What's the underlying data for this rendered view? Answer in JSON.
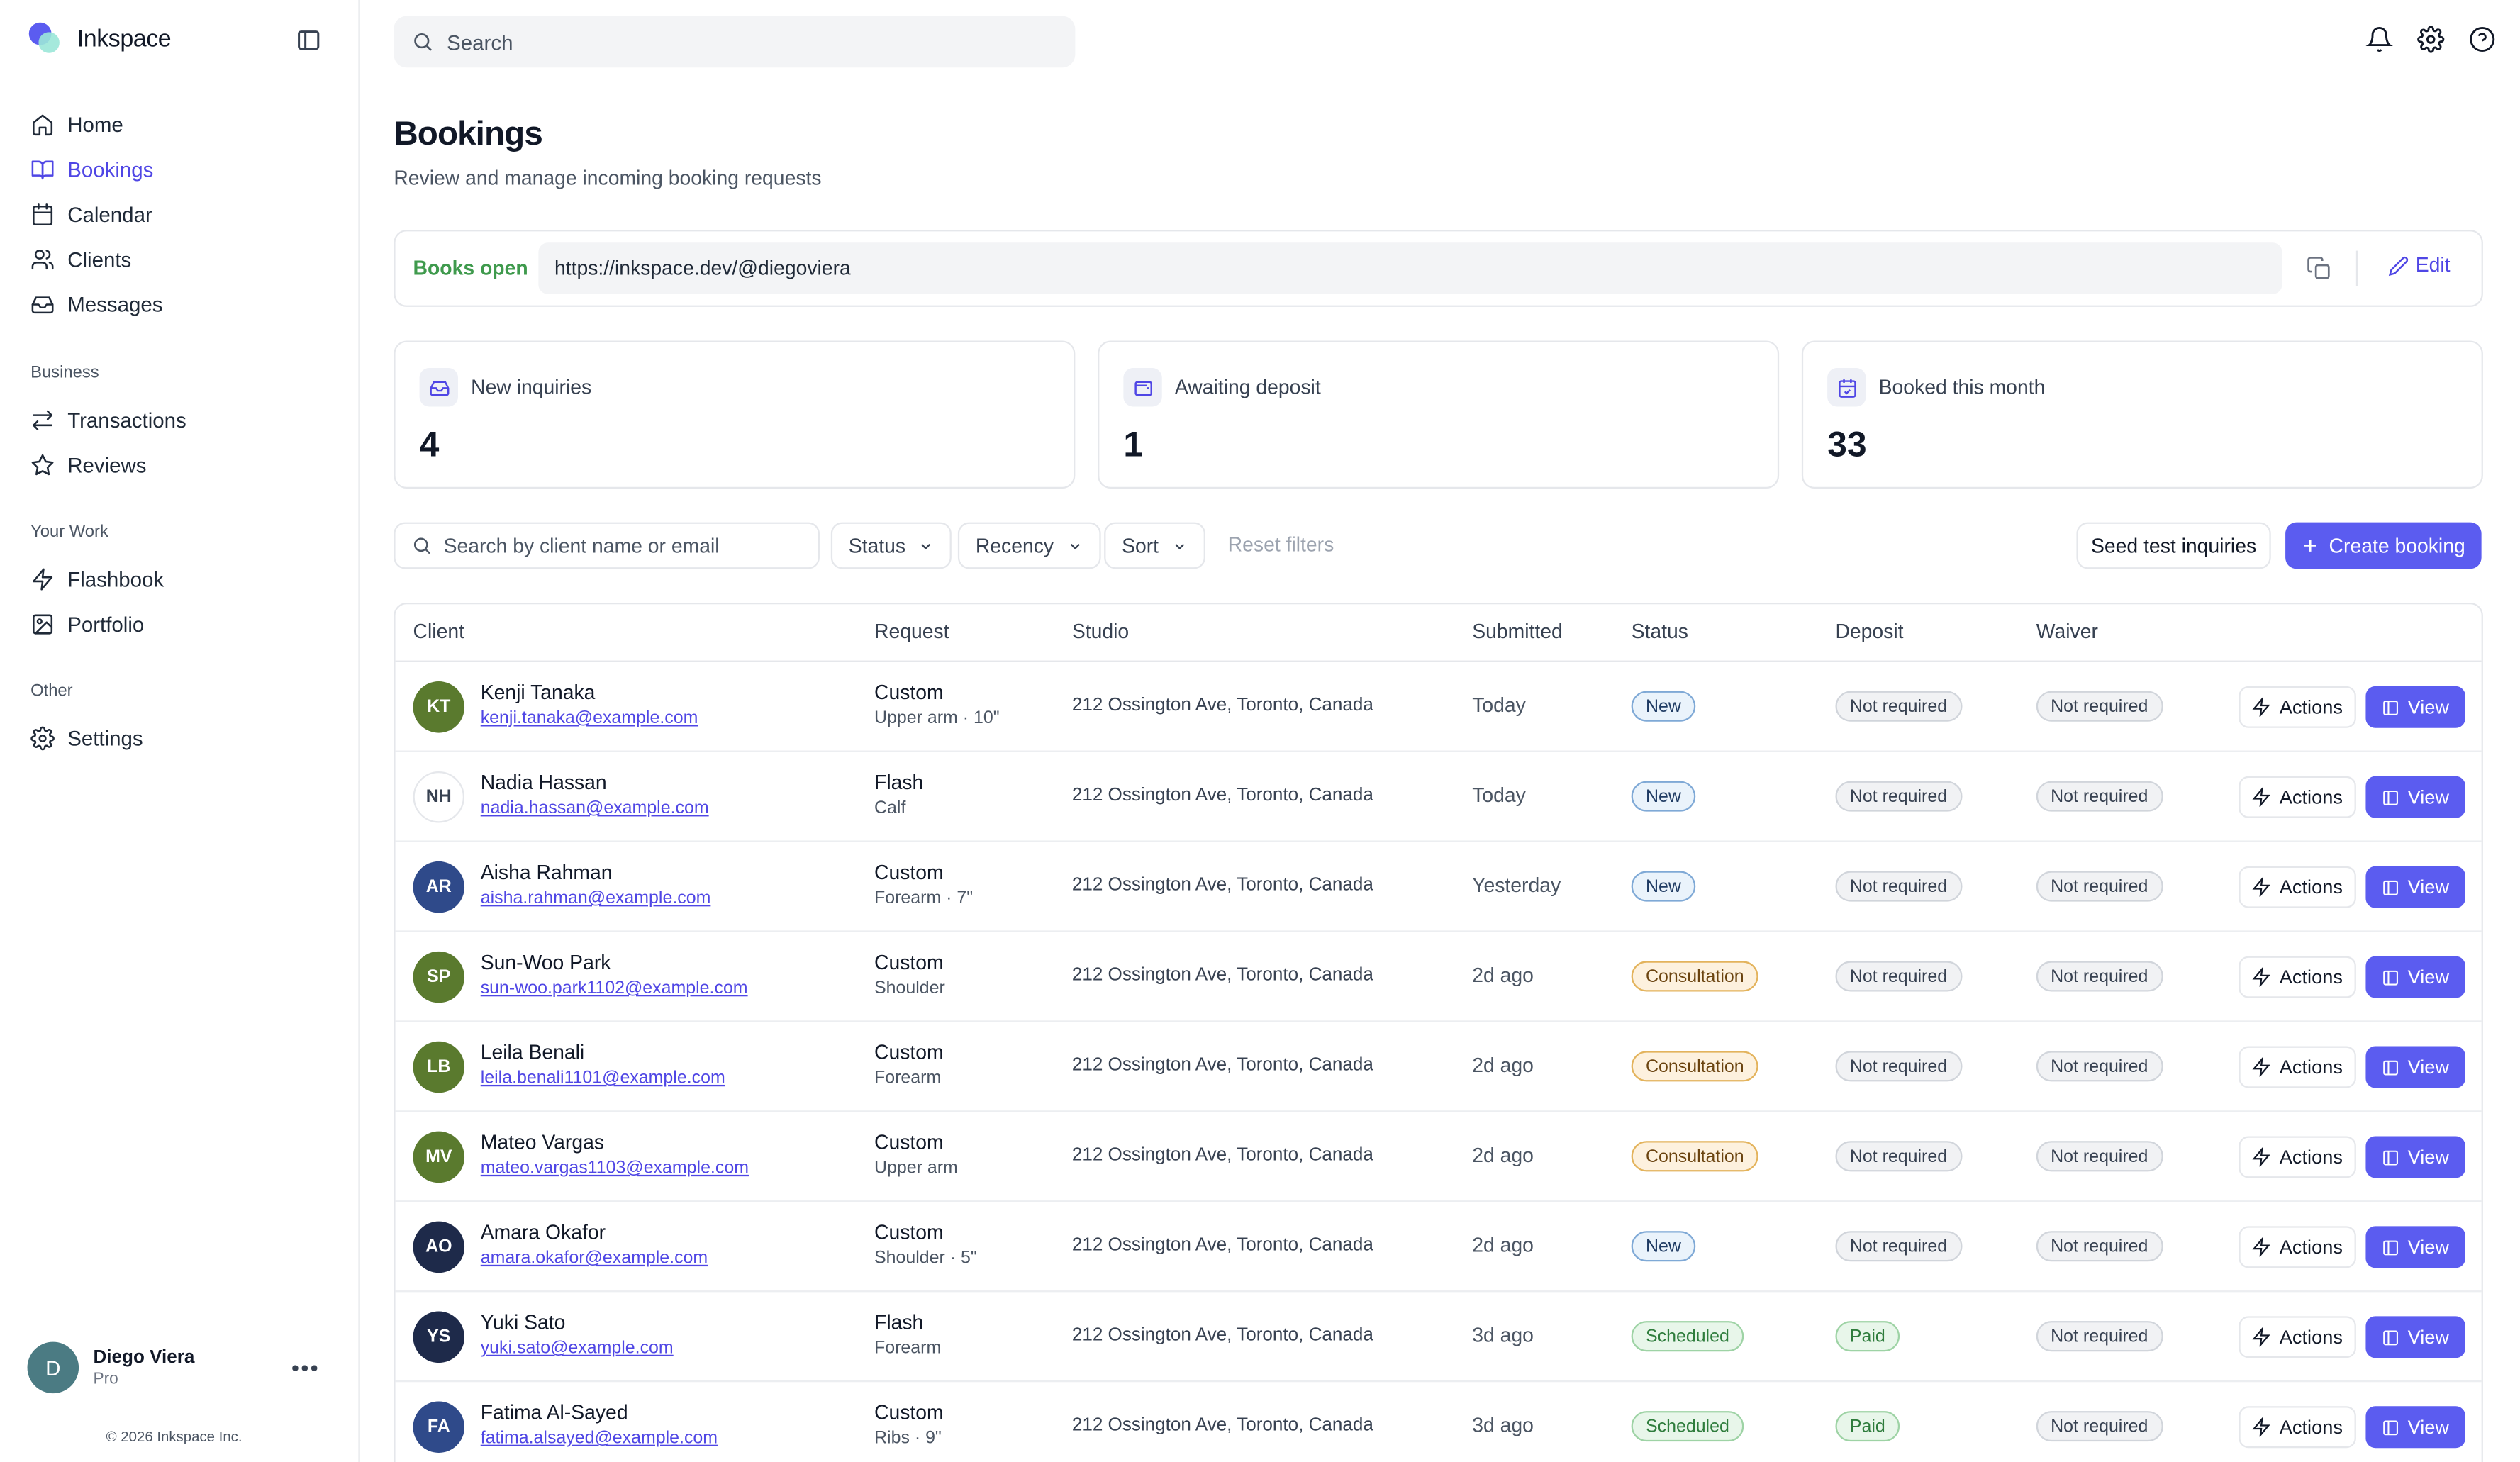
{
  "brand": {
    "name": "Inkspace"
  },
  "nav": {
    "main": [
      {
        "label": "Home",
        "icon": "home-icon"
      },
      {
        "label": "Bookings",
        "icon": "book-open-icon",
        "active": true
      },
      {
        "label": "Calendar",
        "icon": "calendar-icon"
      },
      {
        "label": "Clients",
        "icon": "users-icon"
      },
      {
        "label": "Messages",
        "icon": "inbox-icon"
      }
    ],
    "business_title": "Business",
    "business": [
      {
        "label": "Transactions",
        "icon": "arrows-icon"
      },
      {
        "label": "Reviews",
        "icon": "star-icon"
      }
    ],
    "work_title": "Your Work",
    "work": [
      {
        "label": "Flashbook",
        "icon": "zap-icon"
      },
      {
        "label": "Portfolio",
        "icon": "image-icon"
      }
    ],
    "other_title": "Other",
    "other": [
      {
        "label": "Settings",
        "icon": "gear-icon"
      }
    ]
  },
  "user": {
    "initial": "D",
    "name": "Diego Viera",
    "plan": "Pro",
    "menu": "•••"
  },
  "footer": {
    "copyright": "© 2026 Inkspace Inc."
  },
  "topbar": {
    "search_placeholder": "Search"
  },
  "page": {
    "title": "Bookings",
    "subtitle": "Review and manage incoming booking requests"
  },
  "books": {
    "status": "Books open",
    "url": "https://inkspace.dev/@diegoviera",
    "edit": "Edit"
  },
  "stats": [
    {
      "label": "New inquiries",
      "value": "4"
    },
    {
      "label": "Awaiting deposit",
      "value": "1"
    },
    {
      "label": "Booked this month",
      "value": "33"
    }
  ],
  "filters": {
    "search_placeholder": "Search by client name or email",
    "status": "Status",
    "recency": "Recency",
    "sort": "Sort",
    "reset": "Reset filters",
    "seed": "Seed test inquiries",
    "create": "Create booking"
  },
  "table": {
    "headers": [
      "Client",
      "Request",
      "Studio",
      "Submitted",
      "Status",
      "Deposit",
      "Waiver"
    ],
    "action_label": "Actions",
    "view_label": "View",
    "rows": [
      {
        "initials": "KT",
        "avatar_color": "#5a7a2e",
        "name": "Kenji Tanaka",
        "email": "kenji.tanaka@example.com",
        "type": "Custom",
        "detail": "Upper arm · 10\"",
        "studio": "212 Ossington Ave, Toronto, Canada",
        "submitted": "Today",
        "status": "New",
        "status_kind": "new",
        "deposit": "Not required",
        "deposit_kind": "gray",
        "waiver": "Not required"
      },
      {
        "initials": "NH",
        "avatar_color": "#ffffff",
        "name": "Nadia Hassan",
        "email": "nadia.hassan@example.com",
        "type": "Flash",
        "detail": "Calf",
        "studio": "212 Ossington Ave, Toronto, Canada",
        "submitted": "Today",
        "status": "New",
        "status_kind": "new",
        "deposit": "Not required",
        "deposit_kind": "gray",
        "waiver": "Not required"
      },
      {
        "initials": "AR",
        "avatar_color": "#2f4a8a",
        "name": "Aisha Rahman",
        "email": "aisha.rahman@example.com",
        "type": "Custom",
        "detail": "Forearm · 7\"",
        "studio": "212 Ossington Ave, Toronto, Canada",
        "submitted": "Yesterday",
        "status": "New",
        "status_kind": "new",
        "deposit": "Not required",
        "deposit_kind": "gray",
        "waiver": "Not required"
      },
      {
        "initials": "SP",
        "avatar_color": "#5a7a2e",
        "name": "Sun-Woo Park",
        "email": "sun-woo.park1102@example.com",
        "type": "Custom",
        "detail": "Shoulder",
        "studio": "212 Ossington Ave, Toronto, Canada",
        "submitted": "2d ago",
        "status": "Consultation",
        "status_kind": "consult",
        "deposit": "Not required",
        "deposit_kind": "gray",
        "waiver": "Not required"
      },
      {
        "initials": "LB",
        "avatar_color": "#5a7a2e",
        "name": "Leila Benali",
        "email": "leila.benali1101@example.com",
        "type": "Custom",
        "detail": "Forearm",
        "studio": "212 Ossington Ave, Toronto, Canada",
        "submitted": "2d ago",
        "status": "Consultation",
        "status_kind": "consult",
        "deposit": "Not required",
        "deposit_kind": "gray",
        "waiver": "Not required"
      },
      {
        "initials": "MV",
        "avatar_color": "#5a7a2e",
        "name": "Mateo Vargas",
        "email": "mateo.vargas1103@example.com",
        "type": "Custom",
        "detail": "Upper arm",
        "studio": "212 Ossington Ave, Toronto, Canada",
        "submitted": "2d ago",
        "status": "Consultation",
        "status_kind": "consult",
        "deposit": "Not required",
        "deposit_kind": "gray",
        "waiver": "Not required"
      },
      {
        "initials": "AO",
        "avatar_color": "#1e2a4a",
        "name": "Amara Okafor",
        "email": "amara.okafor@example.com",
        "type": "Custom",
        "detail": "Shoulder · 5\"",
        "studio": "212 Ossington Ave, Toronto, Canada",
        "submitted": "2d ago",
        "status": "New",
        "status_kind": "new",
        "deposit": "Not required",
        "deposit_kind": "gray",
        "waiver": "Not required"
      },
      {
        "initials": "YS",
        "avatar_color": "#1e2a4a",
        "name": "Yuki Sato",
        "email": "yuki.sato@example.com",
        "type": "Flash",
        "detail": "Forearm",
        "studio": "212 Ossington Ave, Toronto, Canada",
        "submitted": "3d ago",
        "status": "Scheduled",
        "status_kind": "sched",
        "deposit": "Paid",
        "deposit_kind": "paid",
        "waiver": "Not required"
      },
      {
        "initials": "FA",
        "avatar_color": "#2f4a8a",
        "name": "Fatima Al-Sayed",
        "email": "fatima.alsayed@example.com",
        "type": "Custom",
        "detail": "Ribs · 9\"",
        "studio": "212 Ossington Ave, Toronto, Canada",
        "submitted": "3d ago",
        "status": "Scheduled",
        "status_kind": "sched",
        "deposit": "Paid",
        "deposit_kind": "paid",
        "waiver": "Not required"
      }
    ]
  }
}
